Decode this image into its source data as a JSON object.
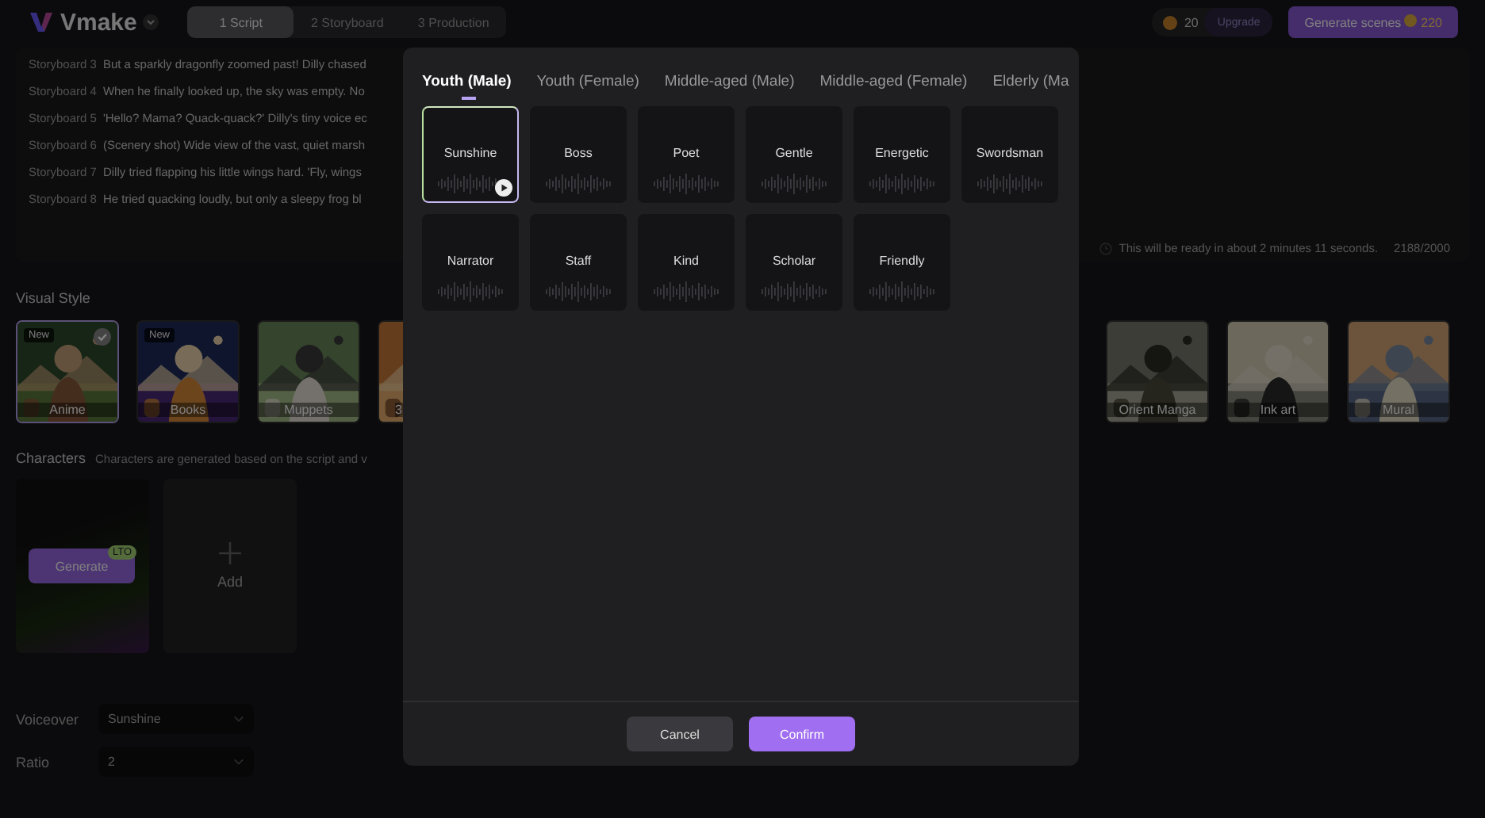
{
  "topbar": {
    "logo": "Vmake",
    "steps": [
      {
        "label": "1 Script",
        "selected": true
      },
      {
        "label": "2 Storyboard",
        "selected": false
      },
      {
        "label": "3 Production",
        "selected": false
      }
    ],
    "credits": "20",
    "upgrade": "Upgrade",
    "generate": {
      "label": "Generate scenes",
      "cost": "220"
    }
  },
  "script": {
    "lines": [
      {
        "label": "Storyboard 3",
        "text": "But a sparkly dragonfly zoomed past! Dilly chased"
      },
      {
        "label": "Storyboard 4",
        "text": "When he finally looked up, the sky was empty. No"
      },
      {
        "label": "Storyboard 5",
        "text": "'Hello? Mama? Quack-quack?' Dilly's tiny voice ec"
      },
      {
        "label": "Storyboard 6",
        "text": "(Scenery shot) Wide view of the vast, quiet marsh"
      },
      {
        "label": "Storyboard 7",
        "text": "Dilly tried flapping his little wings hard. 'Fly, wings"
      },
      {
        "label": "Storyboard 8",
        "text": "He tried quacking loudly, but only a sleepy frog bl"
      }
    ],
    "note": "This will be ready in about 2 minutes 11 seconds.",
    "count": "2188/2000"
  },
  "visual_style": {
    "title": "Visual Style",
    "styles": [
      {
        "label": "Anime",
        "badge": "New",
        "selected": true
      },
      {
        "label": "Books",
        "badge": "New",
        "selected": false
      },
      {
        "label": "Muppets",
        "selected": false
      },
      {
        "label": "3",
        "selected": false
      },
      {
        "label": "Orient Manga",
        "selected": false
      },
      {
        "label": "Ink art",
        "selected": false
      },
      {
        "label": "Mural",
        "selected": false
      }
    ]
  },
  "characters": {
    "title": "Characters",
    "hint": "Characters are generated based on the script and v",
    "generate": "Generate",
    "lto": "LTO",
    "add": "Add"
  },
  "voiceover": {
    "label": "Voiceover",
    "value": "Sunshine"
  },
  "ratio": {
    "label": "Ratio",
    "value": "2"
  },
  "modal": {
    "tabs": [
      {
        "label": "Youth (Male)",
        "selected": true
      },
      {
        "label": "Youth (Female)",
        "selected": false
      },
      {
        "label": "Middle-aged (Male)",
        "selected": false
      },
      {
        "label": "Middle-aged (Female)",
        "selected": false
      },
      {
        "label": "Elderly (Ma",
        "selected": false
      }
    ],
    "voices": [
      {
        "name": "Sunshine",
        "selected": true
      },
      {
        "name": "Boss",
        "selected": false
      },
      {
        "name": "Poet",
        "selected": false
      },
      {
        "name": "Gentle",
        "selected": false
      },
      {
        "name": "Energetic",
        "selected": false
      },
      {
        "name": "Swordsman",
        "selected": false
      },
      {
        "name": "Narrator",
        "selected": false
      },
      {
        "name": "Staff",
        "selected": false
      },
      {
        "name": "Kind",
        "selected": false
      },
      {
        "name": "Scholar",
        "selected": false
      },
      {
        "name": "Friendly",
        "selected": false
      }
    ],
    "cancel": "Cancel",
    "confirm": "Confirm"
  }
}
